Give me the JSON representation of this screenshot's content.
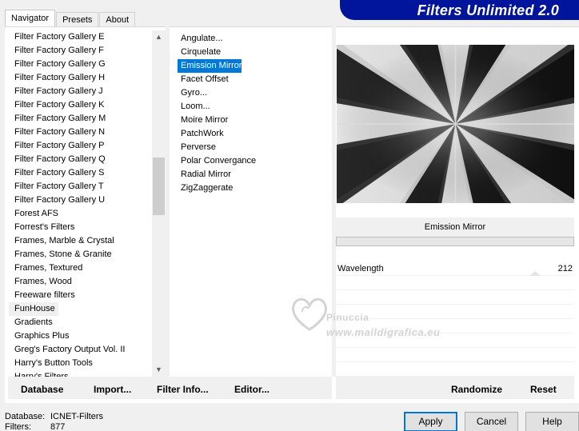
{
  "tabs": [
    "Navigator",
    "Presets",
    "About"
  ],
  "banner_title": "Filters Unlimited 2.0",
  "categories": [
    "Filter Factory Gallery E",
    "Filter Factory Gallery F",
    "Filter Factory Gallery G",
    "Filter Factory Gallery H",
    "Filter Factory Gallery J",
    "Filter Factory Gallery K",
    "Filter Factory Gallery M",
    "Filter Factory Gallery N",
    "Filter Factory Gallery P",
    "Filter Factory Gallery Q",
    "Filter Factory Gallery S",
    "Filter Factory Gallery T",
    "Filter Factory Gallery U",
    "Forest AFS",
    "Forrest's Filters",
    "Frames, Marble & Crystal",
    "Frames, Stone & Granite",
    "Frames, Textured",
    "Frames, Wood",
    "Freeware filters",
    "FunHouse",
    "Gradients",
    "Graphics Plus",
    "Greg's Factory Output Vol. II",
    "Harry's Button Tools",
    "Harry's Filters"
  ],
  "highlighted_category": "FunHouse",
  "filters": [
    "Angulate...",
    "Cirquelate",
    "Emission Mirror",
    "Facet Offset",
    "Gyro...",
    "Loom...",
    "Moire Mirror",
    "PatchWork",
    "Perverse",
    "Polar Convergance",
    "Radial Mirror",
    "ZigZaggerate"
  ],
  "selected_filter": "Emission Mirror",
  "preview": {
    "filter_name": "Emission Mirror",
    "progress": 0
  },
  "params": [
    {
      "label": "Wavelength",
      "value": "212"
    }
  ],
  "watermark": {
    "name": "Pinuccia",
    "url": "www.maildigrafica.eu"
  },
  "left_buttons": [
    "Database",
    "Import...",
    "Filter Info...",
    "Editor..."
  ],
  "right_buttons": [
    "Randomize",
    "Reset"
  ],
  "status": {
    "database_label": "Database:",
    "database_value": "ICNET-Filters",
    "filters_label": "Filters:",
    "filters_value": "877"
  },
  "dialog_buttons": [
    "Apply",
    "Cancel",
    "Help"
  ],
  "colors": {
    "banner": "#00149c",
    "selection": "#0078d7",
    "window_bg": "#f0f0f0"
  },
  "icons": {
    "scroll_up": "chevron-up-icon",
    "scroll_down": "chevron-down-icon"
  }
}
